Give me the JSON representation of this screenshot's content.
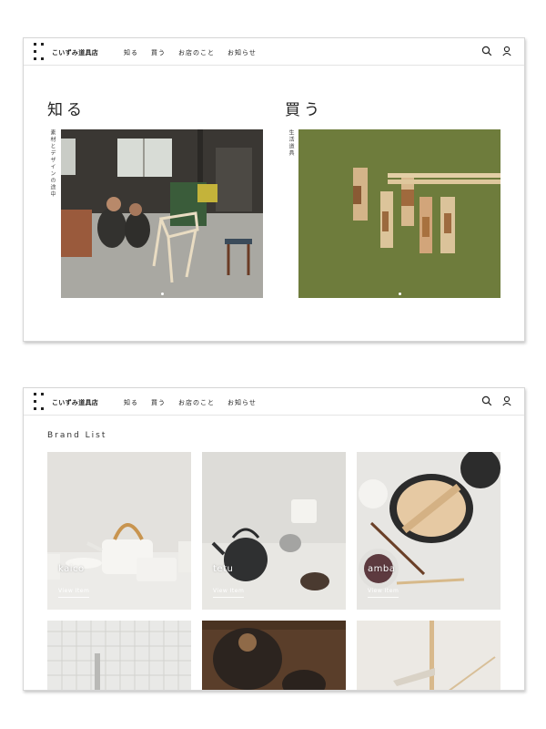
{
  "header": {
    "logo_text": "こいずみ道具店",
    "nav": [
      "知る",
      "買う",
      "お店のこと",
      "お知らせ"
    ]
  },
  "hero": {
    "left": {
      "title": "知る",
      "vertical_caption": "素材とデザインの途中"
    },
    "right": {
      "title": "買う",
      "vertical_caption": "生活道具"
    }
  },
  "brand_list": {
    "title": "Brand List",
    "cards": [
      {
        "name": "kaico",
        "link_label": "View Item"
      },
      {
        "name": "tetu",
        "link_label": "View Item"
      },
      {
        "name": "amba",
        "link_label": "View Item"
      }
    ]
  },
  "colors": {
    "text": "#222222",
    "border": "#e4e4e4",
    "green_backdrop": "#6e7c3c",
    "background": "#ffffff"
  },
  "icons": [
    "logo-mark-icon",
    "search-icon",
    "user-icon"
  ]
}
